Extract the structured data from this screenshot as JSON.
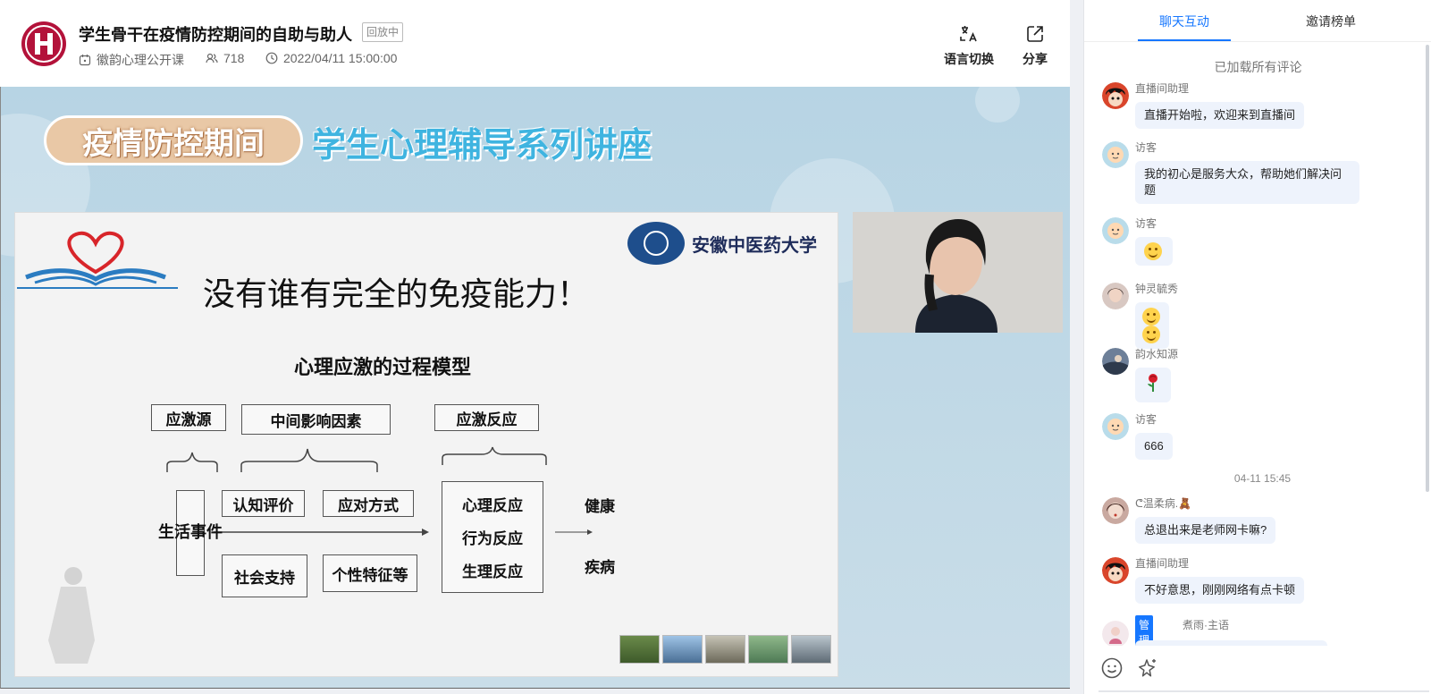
{
  "header": {
    "title": "学生骨干在疫情防控期间的自助与助人",
    "status_badge": "回放中",
    "channel": "徽韵心理公开课",
    "viewers": "718",
    "datetime": "2022/04/11 15:00:00",
    "language_switch_label": "语言切换",
    "share_label": "分享"
  },
  "video": {
    "banner_left": "疫情防控期间",
    "banner_right": "学生心理辅导系列讲座",
    "slide": {
      "university_name": "安徽中医药大学",
      "heading": "没有谁有完全的免疫能力！",
      "model_title": "心理应激的过程模型",
      "stress_source": "应激源",
      "intermediate_factors": "中间影响因素",
      "stress_response": "应激反应",
      "life_events": "生活事件",
      "cognitive_appraisal": "认知评价",
      "coping_style": "应对方式",
      "social_support": "社会支持",
      "personality": "个性特征等",
      "psych_response": "心理反应",
      "behavior_response": "行为反应",
      "physio_response": "生理反应",
      "outcome_health": "健康",
      "outcome_disease": "疾病"
    }
  },
  "chat": {
    "tabs": [
      {
        "label": "聊天互动",
        "active": true
      },
      {
        "label": "邀请榜单",
        "active": false
      }
    ],
    "loaded_notice": "已加载所有评论",
    "timestamp": "04-11 15:45",
    "messages": [
      {
        "user": "直播间助理",
        "text": "直播开始啦，欢迎来到直播间"
      },
      {
        "user": "访客",
        "text": "我的初心是服务大众，帮助她们解决问题"
      },
      {
        "user": "访客",
        "emoji_count": 1
      },
      {
        "user": "钟灵毓秀",
        "emoji_count": 2
      },
      {
        "user": "韵水知源",
        "emoji": "rose"
      },
      {
        "user": "访客",
        "text": "666"
      },
      {
        "user": "ᕦ温柔病.🧸",
        "text": "总退出来是老师网卡嘛?"
      },
      {
        "user": "直播间助理",
        "text": "不好意思，刚刚网络有点卡顿"
      },
      {
        "user": "煮雨·主语",
        "role": "管理员"
      }
    ]
  },
  "colors": {
    "accent": "#1677ff",
    "logo": "#b3123a",
    "bubble": "#eef3fc"
  }
}
